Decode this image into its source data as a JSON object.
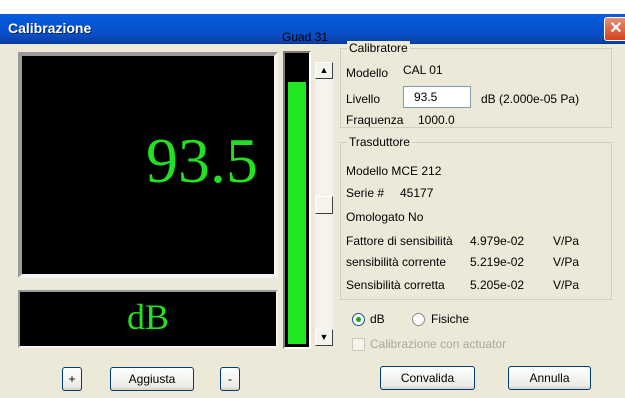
{
  "window": {
    "title": "Calibrazione",
    "close_glyph": "✕"
  },
  "display": {
    "value": "93.5",
    "unit": "dB"
  },
  "gain": {
    "label": "Guad 31",
    "level_fraction": 0.9
  },
  "calibratore": {
    "legend": "Calibratore",
    "modello_label": "Modello",
    "modello_value": "CAL 01",
    "livello_label": "Livello",
    "livello_value": "93.5",
    "livello_unit": "dB (2.000e-05 Pa)",
    "frequenza_label": "Fraquenza",
    "frequenza_value": "1000.0"
  },
  "trasduttore": {
    "legend": "Trasduttore",
    "modello": "Modello MCE 212",
    "serie_label": "Serie #",
    "serie_value": "45177",
    "omologato": "Omologato No",
    "rows": [
      {
        "label": "Fattore di sensibilità",
        "value": "4.979e-02",
        "unit": "V/Pa"
      },
      {
        "label": "sensibilità corrente",
        "value": "5.219e-02",
        "unit": "V/Pa"
      },
      {
        "label": "Sensibilità corretta",
        "value": "5.205e-02",
        "unit": "V/Pa"
      }
    ]
  },
  "units": {
    "option_db": "dB",
    "option_fisiche": "Fisiche",
    "selected": "dB"
  },
  "actuator": {
    "label": "Calibrazione con actuator",
    "checked": false,
    "enabled": false
  },
  "buttons": {
    "plus": "+",
    "aggiusta": "Aggiusta",
    "minus": "-",
    "convalida": "Convalida",
    "annulla": "Annulla"
  },
  "scroll": {
    "up_glyph": "▲",
    "down_glyph": "▼"
  }
}
